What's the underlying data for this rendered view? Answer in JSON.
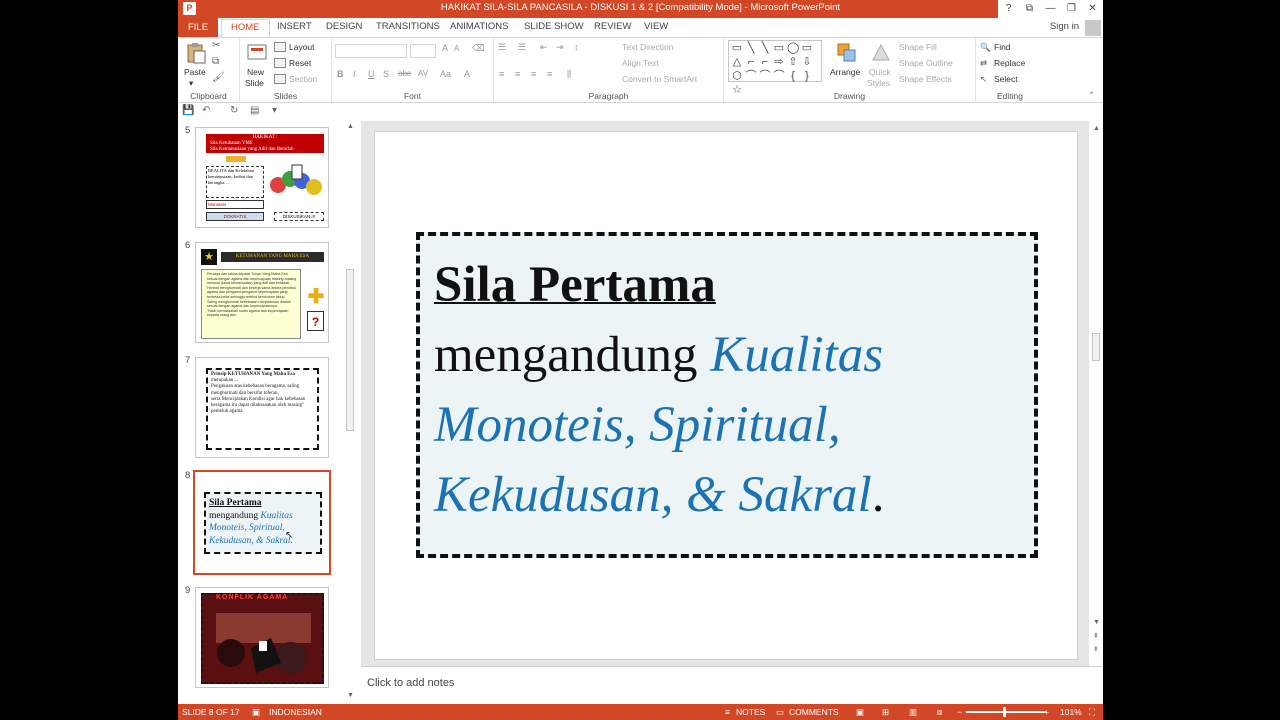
{
  "window": {
    "title": "HAKIKAT SILA-SILA PANCASILA - DISKUSI 1 & 2 [Compatibility Mode] - Microsoft PowerPoint",
    "app_icon": "P",
    "controls": [
      "?",
      "⧉",
      "—",
      "❐",
      "✕"
    ]
  },
  "tabs": [
    "FILE",
    "HOME",
    "INSERT",
    "DESIGN",
    "TRANSITIONS",
    "ANIMATIONS",
    "SLIDE SHOW",
    "REVIEW",
    "VIEW"
  ],
  "signin": "Sign in",
  "ribbon": {
    "clipboard": {
      "paste": "Paste",
      "label": "Clipboard"
    },
    "slides": {
      "new_slide": "New",
      "new_slide2": "Slide",
      "layout": "Layout",
      "reset": "Reset",
      "section": "Section",
      "label": "Slides"
    },
    "font": {
      "label": "Font",
      "bold": "B",
      "italic": "I",
      "underline": "U",
      "strike": "S",
      "shadow": "abc",
      "spacing": "AV",
      "case": "Aa",
      "color": "A"
    },
    "paragraph": {
      "label": "Paragraph",
      "text_direction": "Text Direction",
      "align_text": "Align Text",
      "smartart": "Convert to SmartArt"
    },
    "drawing": {
      "label": "Drawing",
      "arrange": "Arrange",
      "quick": "Quick",
      "styles": "Styles",
      "shape_fill": "Shape Fill",
      "shape_outline": "Shape Outline",
      "shape_effects": "Shape Effects",
      "shapes": [
        "▭",
        "╲",
        "╲",
        "▭",
        "◯",
        "▭",
        "△",
        "⌐",
        "⌐",
        "⇨",
        "⇧",
        "⇩",
        "⬡",
        "⌒",
        "⌒",
        "⌒",
        "{",
        "}",
        "☆"
      ]
    },
    "editing": {
      "label": "Editing",
      "find": "Find",
      "replace": "Replace",
      "select": "Select"
    }
  },
  "thumbnails": [
    {
      "number": "5",
      "title": "HAKIKAT :",
      "items": [
        "Sila Ketuhanan YME",
        "Sila Kemanusiaan yang Adil dan Beradab"
      ],
      "box1": "REALITA dan Kelebihan kemanusiaan, kodrat dan kerangka ...",
      "box2": "Monoteis",
      "box3": "DOKRATIS",
      "box4": "DISKUSIKAN !!!"
    },
    {
      "number": "6",
      "title": "KETUHANAN YANG MAHA ESA",
      "bullets": [
        "Percaya dan takwa kepada Tuhan Yang Maha Esa sesuai dengan agama dan kepercayaan masing-masing menurut dasar kemanusiaan yang adil dan beradab.",
        "Hormat menghormati dan bekerja sama antara pemeluk agama dan penganut-penganut kepercayaan yang berbeda-beda sehingga terbina kerukunan hidup.",
        "Saling menghormati kebebasan menjalankan ibadah sesuai dengan agama dan kepercayaannya.",
        "Tidak memaksakan suatu agama dan kepercayaan kepada orang lain."
      ]
    },
    {
      "number": "7",
      "title": "Prinsip KETUHANAN Yang Maha Esa",
      "lines": [
        "merupakan ...",
        "Pengakuan atas kebebasan beragama, saling menghormati dan bersifat toleran,",
        "serta Menciptakan Kondisi agar hak kebebasan beragama itu dapat dilaksanakan oleh masing\" pemeluk agama."
      ]
    },
    {
      "number": "8",
      "line1": "Sila Pertama",
      "line2": "mengandung ",
      "line2b": "Kualitas",
      "line3": "Monoteis, Spiritual,",
      "line4": "Kekudusan, & Sakral."
    },
    {
      "number": "9",
      "title": "KONFLIK AGAMA"
    }
  ],
  "slide": {
    "title": "Sila Pertama",
    "line2_plain": "mengandung ",
    "line2_blue": "Kualitas",
    "line3_blue": "Monoteis, Spiritual,",
    "line4_blue": "Kekudusan, & Sakral",
    "line4_end": "."
  },
  "notes": {
    "placeholder": "Click to add notes"
  },
  "status": {
    "slide": "SLIDE 8 OF 17",
    "language": "INDONESIAN",
    "notes": "NOTES",
    "comments": "COMMENTS",
    "zoom": "101%"
  },
  "colors": {
    "accent": "#d24726",
    "slide_blue": "#1c73b3",
    "textbox_bg": "#edf4f6"
  }
}
